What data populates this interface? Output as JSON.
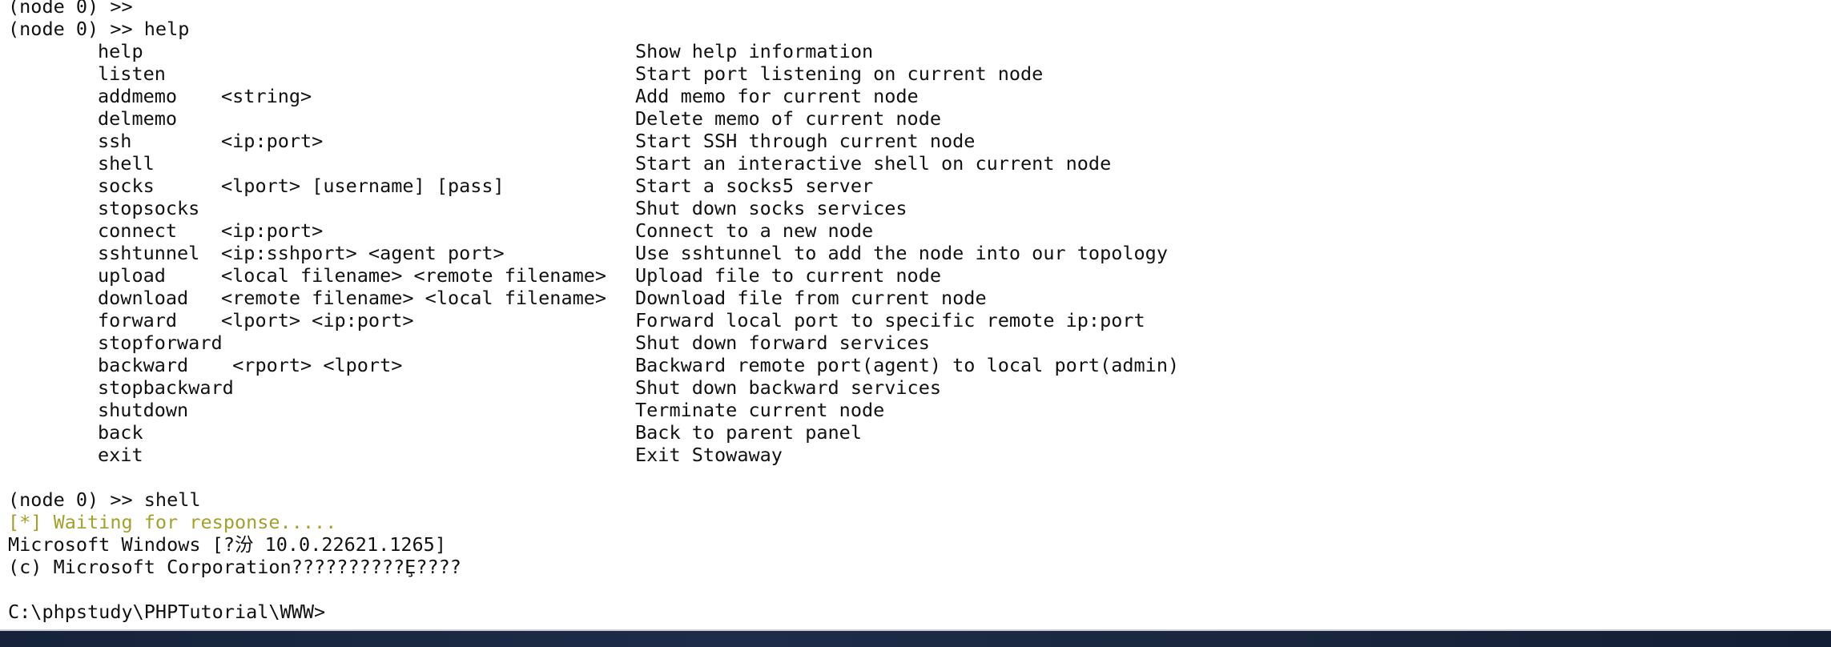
{
  "terminal": {
    "lines_top": [
      "(node 0) >>",
      "(node 0) >> help"
    ],
    "commands": [
      {
        "name": "help",
        "args": "",
        "desc": "Show help information"
      },
      {
        "name": "listen",
        "args": "",
        "desc": "Start port listening on current node"
      },
      {
        "name": "addmemo",
        "args": "<string>",
        "desc": "Add memo for current node"
      },
      {
        "name": "delmemo",
        "args": "",
        "desc": "Delete memo of current node"
      },
      {
        "name": "ssh",
        "args": "<ip:port>",
        "desc": "Start SSH through current node"
      },
      {
        "name": "shell",
        "args": "",
        "desc": "Start an interactive shell on current node"
      },
      {
        "name": "socks",
        "args": "<lport> [username] [pass]",
        "desc": "Start a socks5 server"
      },
      {
        "name": "stopsocks",
        "args": "",
        "desc": "Shut down socks services"
      },
      {
        "name": "connect",
        "args": "<ip:port>",
        "desc": "Connect to a new node"
      },
      {
        "name": "sshtunnel",
        "args": "<ip:sshport> <agent port>",
        "desc": "Use sshtunnel to add the node into our topology"
      },
      {
        "name": "upload",
        "args": "<local filename> <remote filename>",
        "desc": "Upload file to current node"
      },
      {
        "name": "download",
        "args": "<remote filename> <local filename>",
        "desc": "Download file from current node"
      },
      {
        "name": "forward",
        "args": "<lport> <ip:port>",
        "desc": "Forward local port to specific remote ip:port"
      },
      {
        "name": "stopforward",
        "args": "",
        "desc": "Shut down forward services"
      },
      {
        "name": "backward",
        "args": " <rport> <lport>",
        "desc": "Backward remote port(agent) to local port(admin)"
      },
      {
        "name": "stopbackward",
        "args": "",
        "desc": "Shut down backward services"
      },
      {
        "name": "shutdown",
        "args": "",
        "desc": "Terminate current node"
      },
      {
        "name": "back",
        "args": "",
        "desc": "Back to parent panel"
      },
      {
        "name": "exit",
        "args": "",
        "desc": "Exit Stowaway"
      }
    ],
    "shell_prompt": "(node 0) >> shell",
    "waiting": "[*] Waiting for response.....",
    "windows_version": "Microsoft Windows [?汾 10.0.22621.1265]",
    "copyright": "(c) Microsoft Corporation??????????Ȩ????",
    "cwd_prompt": "C:\\phpstudy\\PHPTutorial\\WWW>"
  },
  "colors": {
    "text": "#111111",
    "waiting": "#a3a02e",
    "background": "#ffffff"
  }
}
